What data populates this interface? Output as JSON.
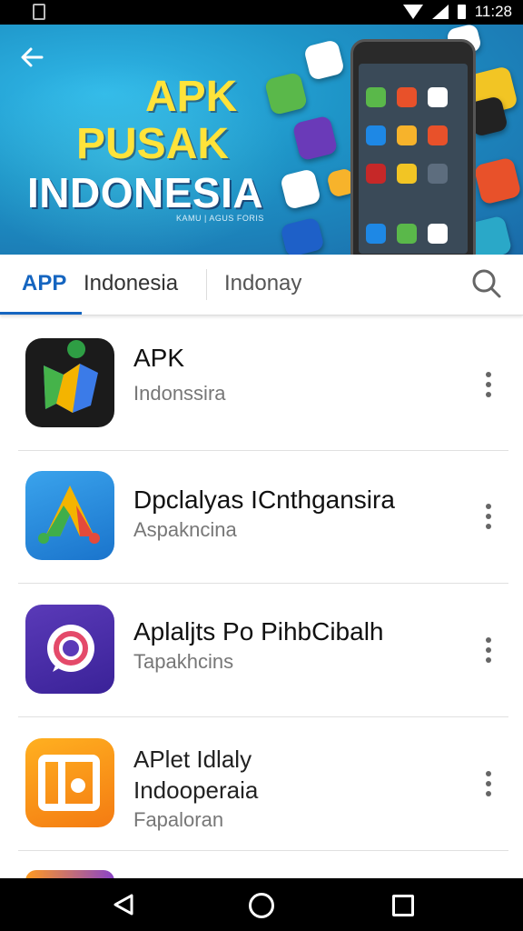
{
  "statusbar": {
    "time": "11:28"
  },
  "banner": {
    "line1": "APK",
    "line2": "PUSAK",
    "line3": "INDONESIA",
    "tagline": "KAMU | AGUS FORIS"
  },
  "tabs": {
    "app": "APP",
    "indonesia": "Indonesia",
    "indonay": "Indonay"
  },
  "apps": [
    {
      "title": "APK",
      "subtitle": "Indonssira"
    },
    {
      "title": "Dpclalyas ICnthgansira",
      "subtitle": "Aspakncina"
    },
    {
      "title": "Aplaljts Po PihbCibalh",
      "subtitle": "Tapakhcins"
    },
    {
      "title": "APlet Idlaly",
      "title2": "Indooperaia",
      "subtitle": "Fapaloran"
    }
  ],
  "colors": {
    "accent": "#1565c0",
    "banner": "#1e95c8",
    "headline": "#ffe33a"
  }
}
